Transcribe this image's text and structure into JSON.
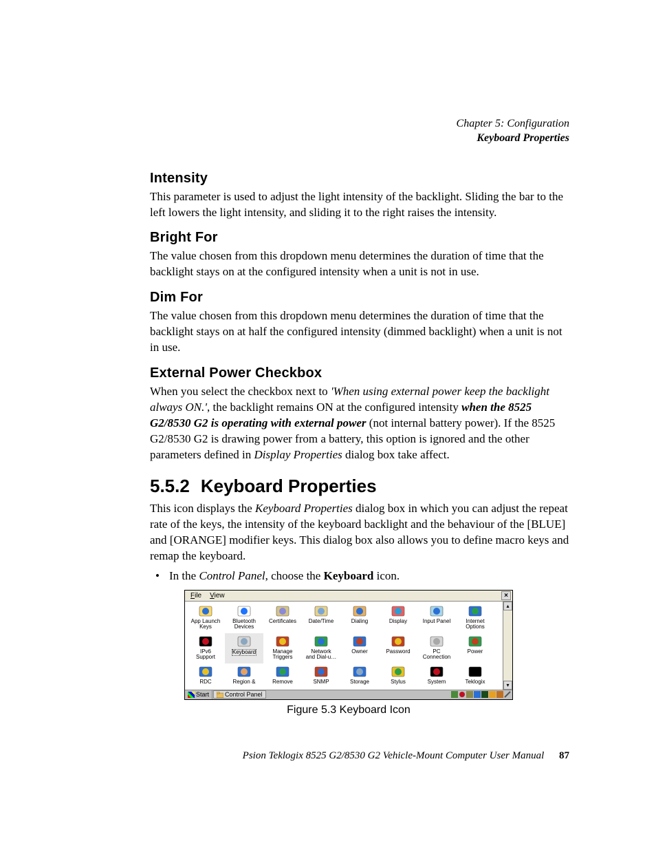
{
  "header": {
    "chapter": "Chapter 5: Configuration",
    "section": "Keyboard Properties"
  },
  "sections": {
    "intensity": {
      "title": "Intensity",
      "body": "This parameter is used to adjust the light intensity of the backlight. Sliding the bar to the left lowers the light intensity, and sliding it to the right raises the intensity."
    },
    "bright_for": {
      "title": "Bright For",
      "body": "The value chosen from this dropdown menu determines the duration of time that the backlight stays on at the configured intensity when a unit is not in use."
    },
    "dim_for": {
      "title": "Dim For",
      "body": "The value chosen from this dropdown menu determines the duration of time that the backlight stays on at half the configured intensity (dimmed backlight) when a unit is not in use."
    },
    "ext_power": {
      "title": "External Power Checkbox",
      "body_pre": "When you select the checkbox next to ",
      "body_q": "'When using external power keep the backlight always ON.'",
      "body_mid1": ", the backlight remains ON at the configured intensity ",
      "body_bi": "when the 8525 G2/8530 G2 is operating with external power",
      "body_mid2": " (not internal battery power). If the 8525 G2/8530 G2 is drawing power from a battery, this option is ignored and the other parameters defined in ",
      "body_i2": "Display Properties",
      "body_post": " dialog box take affect."
    },
    "keyboard": {
      "num": "5.5.2",
      "title": "Keyboard Properties",
      "body_pre": "This icon displays the ",
      "body_i": "Keyboard Properties",
      "body_post": " dialog box in which you can adjust the repeat rate of the keys, the intensity of the keyboard backlight and the behaviour of the [BLUE] and [ORANGE] modifier keys. This dialog box also allows you to define macro keys and remap the keyboard.",
      "bullet_pre": "In the ",
      "bullet_i": "Control Panel",
      "bullet_mid": ", choose the ",
      "bullet_b": "Keyboard",
      "bullet_post": " icon."
    }
  },
  "figure": {
    "caption": "Figure 5.3 Keyboard Icon",
    "menubar": {
      "file": "File",
      "view": "View",
      "close": "×"
    },
    "scroll": {
      "up": "▴",
      "down": "▾"
    },
    "taskbar": {
      "start": "Start",
      "task": "Control Panel"
    },
    "rows": [
      [
        {
          "label": "App Launch\nKeys",
          "icon": "app-launch",
          "c1": "#2a6fd6",
          "c2": "#ffd966"
        },
        {
          "label": "Bluetooth\nDevices",
          "icon": "bluetooth",
          "c1": "#1e73ff",
          "c2": "#fff"
        },
        {
          "label": "Certificates",
          "icon": "certificates",
          "c1": "#8a8ad6",
          "c2": "#d6c488"
        },
        {
          "label": "Date/Time",
          "icon": "datetime",
          "c1": "#7aa6d6",
          "c2": "#e8d28a"
        },
        {
          "label": "Dialing",
          "icon": "dialing",
          "c1": "#2a6fd6",
          "c2": "#e8b060"
        },
        {
          "label": "Display",
          "icon": "display",
          "c1": "#2a9fd6",
          "c2": "#e86060"
        },
        {
          "label": "Input Panel",
          "icon": "input-panel",
          "c1": "#2a6fd6",
          "c2": "#a8d6e8"
        },
        {
          "label": "Internet\nOptions",
          "icon": "internet",
          "c1": "#2a9f4a",
          "c2": "#2a6fd6"
        }
      ],
      [
        {
          "label": "IPv6\nSupport",
          "icon": "ipv6",
          "c1": "#c01020",
          "c2": "#000"
        },
        {
          "label": "Keyboard",
          "icon": "keyboard",
          "c1": "#8aa6c0",
          "c2": "#d6d6d6",
          "selected": true
        },
        {
          "label": "Manage\nTriggers",
          "icon": "triggers",
          "c1": "#e8c020",
          "c2": "#c04020"
        },
        {
          "label": "Network\nand Dial-u…",
          "icon": "network",
          "c1": "#2a6fd6",
          "c2": "#2a9f4a"
        },
        {
          "label": "Owner",
          "icon": "owner",
          "c1": "#c04020",
          "c2": "#2a6fd6"
        },
        {
          "label": "Password",
          "icon": "password",
          "c1": "#e8c020",
          "c2": "#c04020"
        },
        {
          "label": "PC\nConnection",
          "icon": "pc-conn",
          "c1": "#a8a8a8",
          "c2": "#d6d6d6"
        },
        {
          "label": "Power",
          "icon": "power",
          "c1": "#c04020",
          "c2": "#2a9f4a"
        }
      ],
      [
        {
          "label": "RDC",
          "icon": "rdc",
          "c1": "#e8c020",
          "c2": "#2a6fd6"
        },
        {
          "label": "Region &",
          "icon": "region",
          "c1": "#e8a060",
          "c2": "#2a6fd6"
        },
        {
          "label": "Remove",
          "icon": "remove",
          "c1": "#2a9f4a",
          "c2": "#2a6fd6"
        },
        {
          "label": "SNMP",
          "icon": "snmp",
          "c1": "#2a6fd6",
          "c2": "#c04020"
        },
        {
          "label": "Storage",
          "icon": "storage",
          "c1": "#8aa6c0",
          "c2": "#2a6fd6"
        },
        {
          "label": "Stylus",
          "icon": "stylus",
          "c1": "#2a9f4a",
          "c2": "#e8c020"
        },
        {
          "label": "System",
          "icon": "system",
          "c1": "#c01020",
          "c2": "#000"
        },
        {
          "label": "Teklogix",
          "icon": "teklogix",
          "c1": "#000",
          "c2": "#000"
        }
      ]
    ]
  },
  "footer": {
    "text": "Psion Teklogix 8525 G2/8530 G2 Vehicle-Mount Computer User Manual",
    "page": "87"
  }
}
